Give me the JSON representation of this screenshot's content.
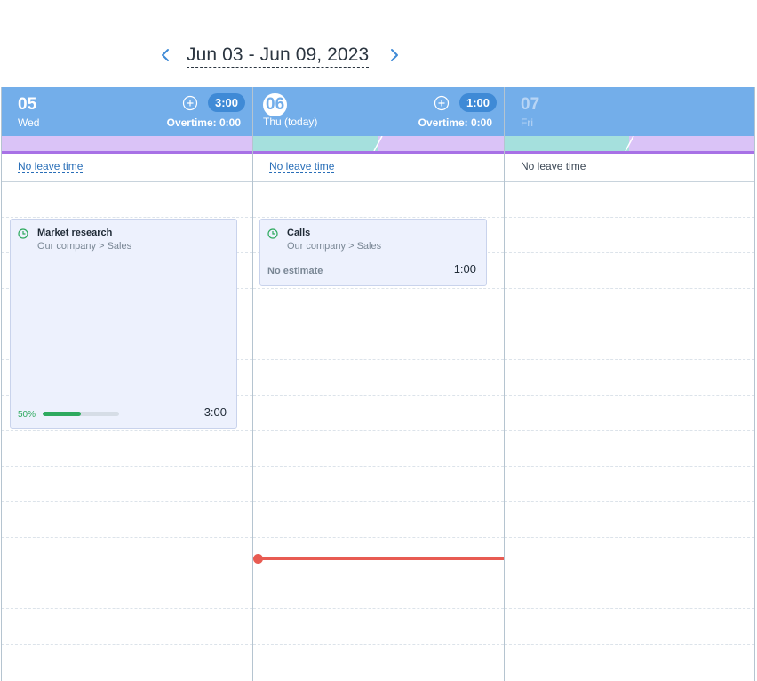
{
  "navigation": {
    "date_range": "Jun 03 - Jun 09, 2023",
    "prev_icon": "chevron-left-icon",
    "next_icon": "chevron-right-icon"
  },
  "days": [
    {
      "number": "05",
      "name": "Wed",
      "total": "3:00",
      "overtime": "Overtime:  0:00",
      "leave": "No leave time",
      "tasks": [
        {
          "title": "Market research",
          "path": "Our company > Sales",
          "duration": "3:00",
          "progress_label": "50%",
          "progress": 0.5
        }
      ]
    },
    {
      "number": "06",
      "name": "Thu (today)",
      "total": "1:00",
      "overtime": "Overtime:  0:00",
      "leave": "No leave time",
      "tasks": [
        {
          "title": "Calls",
          "path": "Our company > Sales",
          "duration": "1:00",
          "estimate": "No estimate"
        }
      ]
    },
    {
      "number": "07",
      "name": "Fri",
      "leave": "No leave time"
    }
  ],
  "colors": {
    "header": "#73aeea",
    "badge": "#3f8ad6",
    "strip_purple": "#dac3f7",
    "strip_teal": "#a5e0dd",
    "progress": "#2eaa5f",
    "current_time": "#e85b52"
  }
}
